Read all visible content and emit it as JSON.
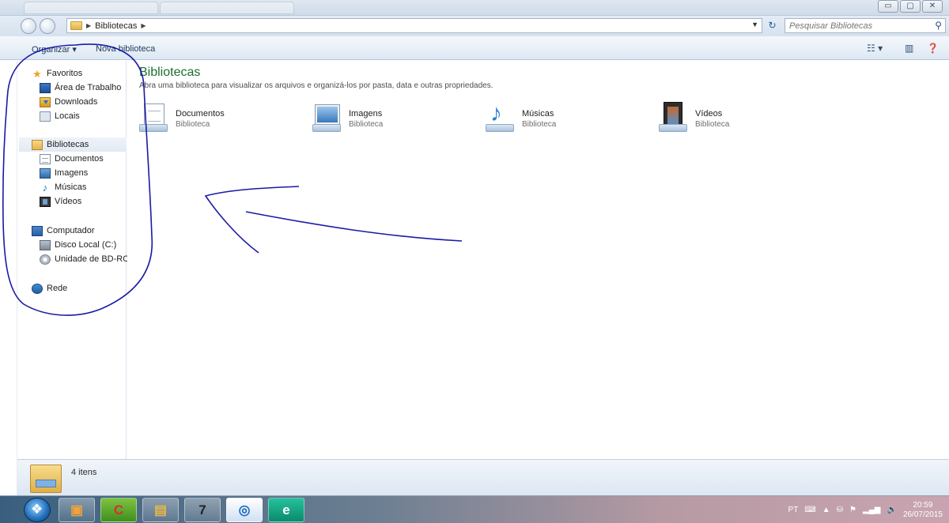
{
  "address_bar": {
    "location": "Bibliotecas",
    "search_placeholder": "Pesquisar Bibliotecas"
  },
  "toolbar": {
    "organize_label": "Organizar",
    "new_library_label": "Nova biblioteca"
  },
  "nav": {
    "favorites": {
      "label": "Favoritos",
      "items": [
        "Área de Trabalho",
        "Downloads",
        "Locais"
      ]
    },
    "libraries": {
      "label": "Bibliotecas",
      "items": [
        "Documentos",
        "Imagens",
        "Músicas",
        "Vídeos"
      ]
    },
    "computer": {
      "label": "Computador",
      "items": [
        "Disco Local (C:)",
        "Unidade de BD-ROM"
      ]
    },
    "network": {
      "label": "Rede"
    }
  },
  "content": {
    "title": "Bibliotecas",
    "description": "Abra uma biblioteca para visualizar os arquivos e organizá-los por pasta, data e outras propriedades.",
    "libraries": [
      {
        "name": "Documentos",
        "type": "Biblioteca",
        "icon": "documents-library-icon"
      },
      {
        "name": "Imagens",
        "type": "Biblioteca",
        "icon": "pictures-library-icon"
      },
      {
        "name": "Músicas",
        "type": "Biblioteca",
        "icon": "music-library-icon"
      },
      {
        "name": "Vídeos",
        "type": "Biblioteca",
        "icon": "videos-library-icon"
      }
    ]
  },
  "details": {
    "item_count": "4 itens"
  },
  "taskbar": {
    "language": "PT",
    "time": "20:59",
    "date": "26/07/2015"
  },
  "annotation": {
    "color": "#1a1aa6"
  }
}
